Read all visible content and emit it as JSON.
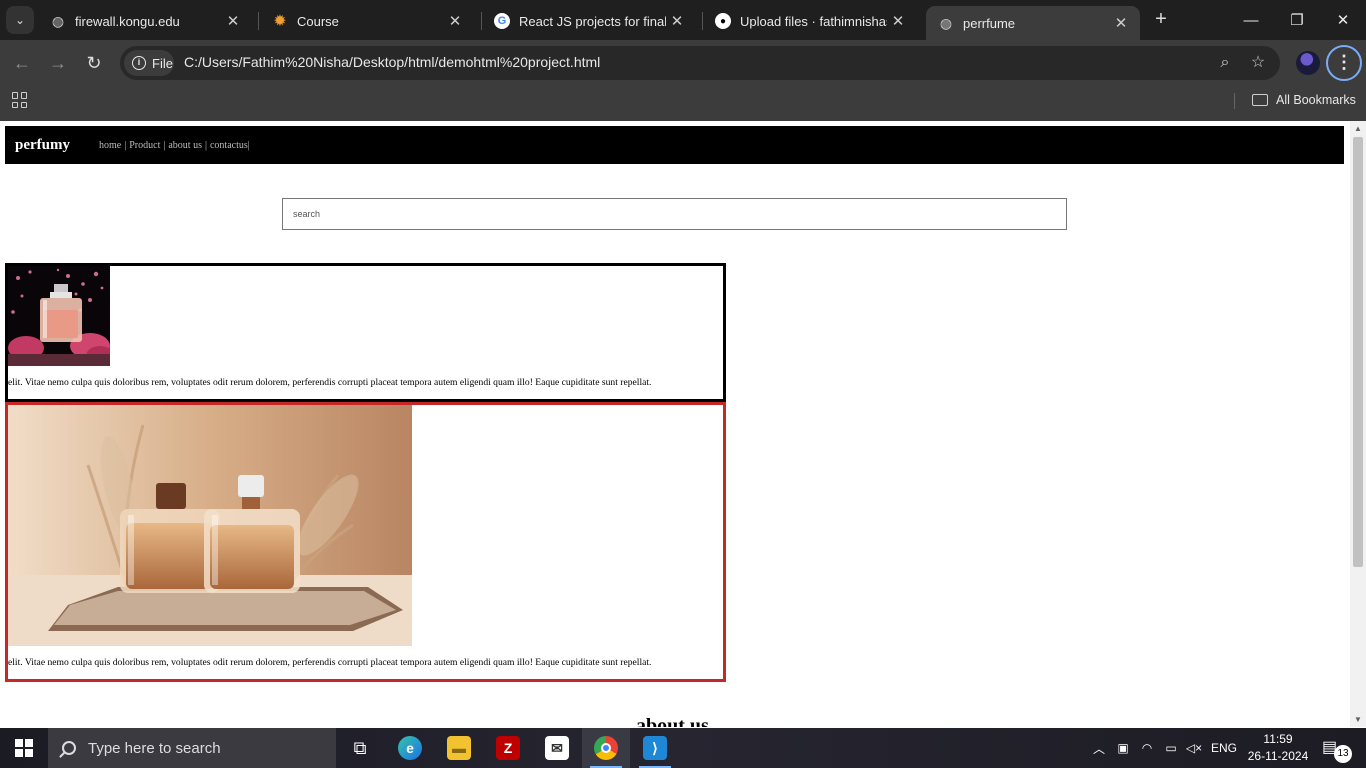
{
  "browser": {
    "tabs": [
      {
        "title": "firewall.kongu.edu",
        "icon": "globe-icon"
      },
      {
        "title": "Course",
        "icon": "sun-icon"
      },
      {
        "title": "React JS projects for final year",
        "icon": "google-icon"
      },
      {
        "title": "Upload files · fathimnishasye",
        "icon": "github-icon"
      },
      {
        "title": "perrfume",
        "icon": "globe-icon",
        "active": true
      }
    ],
    "address_chip": "File",
    "url": "C:/Users/Fathim%20Nisha/Desktop/html/demohtml%20project.html",
    "bookmarks_label": "All Bookmarks"
  },
  "page": {
    "brand": "perfumy",
    "nav": [
      "home",
      "Product",
      "about us",
      "contactus"
    ],
    "nav_sep": "|",
    "search_placeholder": "search",
    "cards": [
      {
        "text": "elit. Vitae nemo culpa quis doloribus rem, voluptates odit rerum dolorem, perferendis corrupti placeat tempora autem eligendi quam illo! Eaque cupiditate sunt repellat.",
        "image": "perfume-bottle-roses",
        "border_color": "#000000"
      },
      {
        "text": "elit. Vitae nemo culpa quis doloribus rem, voluptates odit rerum dolorem, perferendis corrupti placeat tempora autem eligendi quam illo! Eaque cupiditate sunt repellat.",
        "image": "two-perfume-bottles-tray",
        "border_color": "#c62828"
      }
    ],
    "about_heading": "about us"
  },
  "taskbar": {
    "search_text": "Type here to search",
    "lang": "ENG",
    "time": "11:59",
    "date": "26-11-2024",
    "notifications": "13",
    "apps": [
      "task-view-icon",
      "edge-icon",
      "file-explorer-icon",
      "filezilla-icon",
      "mail-icon",
      "chrome-icon",
      "vscode-icon"
    ]
  },
  "colors": {
    "nav_bg": "#000000",
    "card2_border": "#c62828",
    "chrome_dark": "#1f1f1f",
    "chrome_toolbar": "#3c3c3c"
  }
}
